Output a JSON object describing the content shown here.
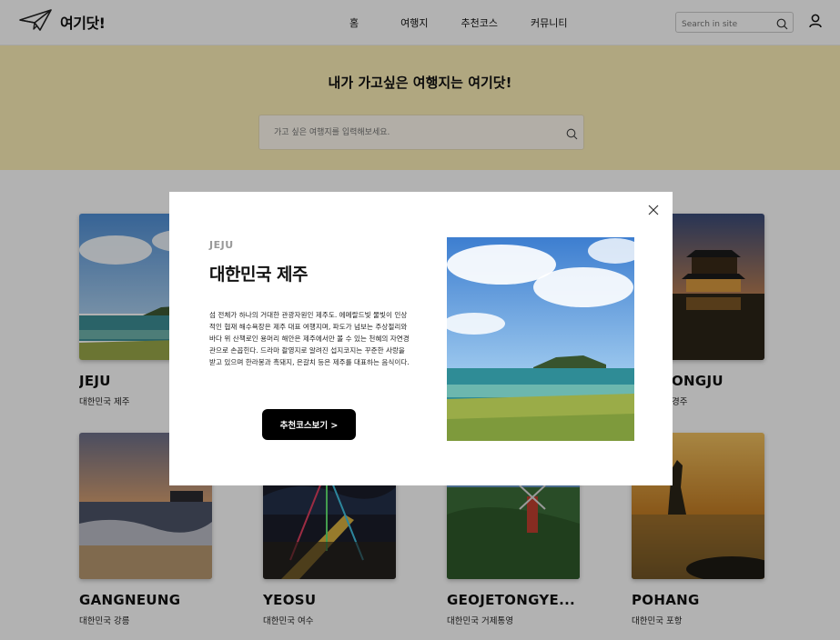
{
  "header": {
    "logo_text": "여기닷!",
    "nav": [
      "홈",
      "여행지",
      "추천코스",
      "커뮤니티"
    ],
    "search_placeholder": "Search in site"
  },
  "hero": {
    "title": "내가 가고싶은 여행지는 여기닷!",
    "search_placeholder": "가고 싶은 여행지를 입력해보세요."
  },
  "cards": [
    {
      "name": "JEJU",
      "sub": "대한민국 제주"
    },
    {
      "name": "GYEONGJU",
      "name_visible": "ONGJU",
      "sub": "대한민국 경주",
      "sub_visible": "경주"
    },
    {
      "name": "GANGNEUNG",
      "sub": "대한민국 강릉"
    },
    {
      "name": "YEOSU",
      "sub": "대한민국 여수"
    },
    {
      "name": "GEOJETONGYE...",
      "sub": "대한민국 거제통영"
    },
    {
      "name": "POHANG",
      "sub": "대한민국 포항"
    }
  ],
  "modal": {
    "tag": "JEJU",
    "title": "대한민국 제주",
    "description": "섬 전체가 하나의 거대한 관광자원인 제주도. 에메랄드빛 물빛이 인상적인 협재 해수욕장은 제주 대표 여행지며, 파도가 넘보는 주상절리와 바다 위 산책로인 용머리 해안은 제주에서만 볼 수 있는 천혜의 자연경관으로 손꼽힌다. 드라마 촬영지로 알려진 섭지코지는 꾸준한 사랑을 받고 있으며 한라봉과 흑돼지, 은갈치 등은 제주를 대표하는 음식이다.",
    "cta_label": "추천코스보기 >"
  }
}
